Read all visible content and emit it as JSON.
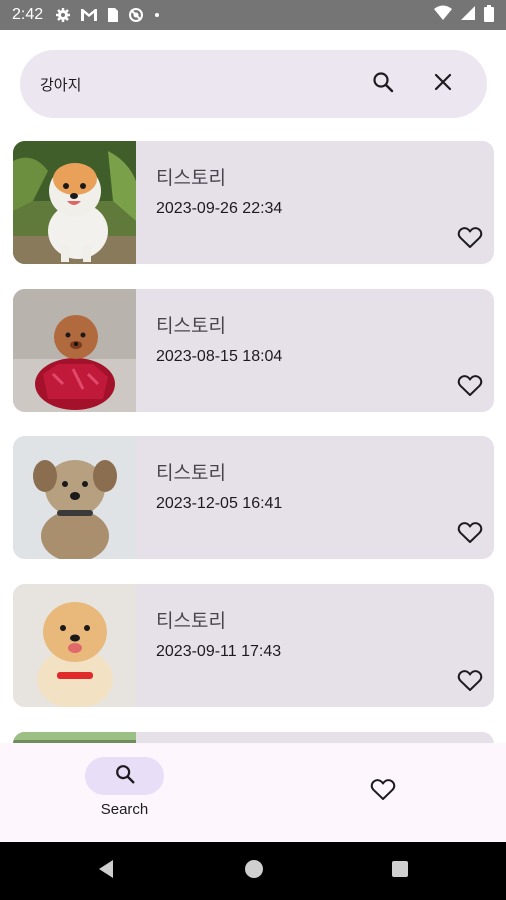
{
  "status_bar": {
    "time": "2:42",
    "icons": [
      "gear-icon",
      "gmail-icon",
      "sim-icon",
      "sync-icon",
      "dot-icon"
    ],
    "right_icons": [
      "wifi-icon",
      "signal-icon",
      "battery-icon"
    ]
  },
  "search": {
    "value": "강아지",
    "search_icon": "search-icon",
    "clear_icon": "close-icon"
  },
  "results": [
    {
      "title": "티스토리",
      "date": "2023-09-26 22:34",
      "image": "white pomeranian puppy",
      "favorite": false
    },
    {
      "title": "티스토리",
      "date": "2023-08-15 18:04",
      "image": "poodle in red sweater",
      "favorite": false
    },
    {
      "title": "티스토리",
      "date": "2023-12-05 16:41",
      "image": "yorkshire terrier",
      "favorite": false
    },
    {
      "title": "티스토리",
      "date": "2023-09-11 17:43",
      "image": "smiling pomeranian",
      "favorite": false
    }
  ],
  "bottom_nav": {
    "items": [
      {
        "label": "Search",
        "icon": "search-icon",
        "selected": true
      },
      {
        "label": "",
        "icon": "heart-icon",
        "selected": false
      }
    ]
  },
  "colors": {
    "search_bg": "#ece6f0",
    "card_bg": "#e6e0e9",
    "nav_bg": "#fdf7fd",
    "nav_selected": "#e8def8",
    "status_bar": "#757575"
  }
}
